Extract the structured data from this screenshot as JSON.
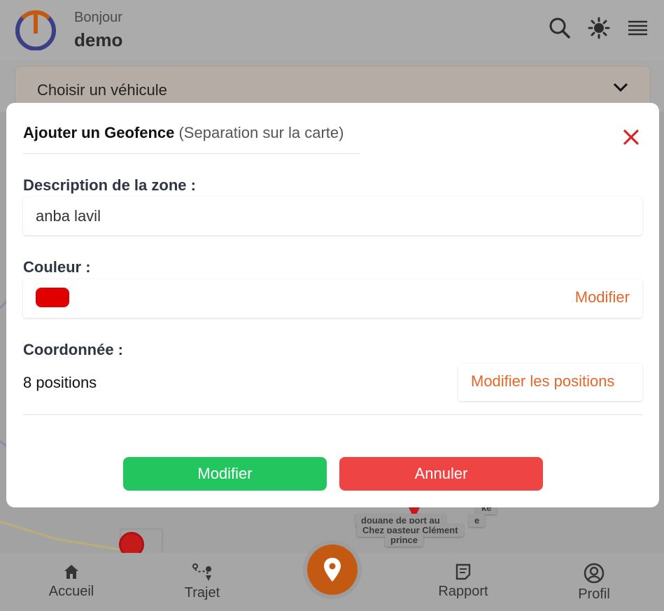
{
  "header": {
    "greeting": "Bonjour",
    "username": "demo",
    "icons": [
      "search-icon",
      "settings-sun-icon",
      "menu-icon"
    ]
  },
  "vehicle_select": {
    "label": "Choisir un véhicule"
  },
  "map": {
    "labels": [
      "douane de port au",
      "Chez pasteur Clément",
      "prince",
      "ke",
      "e"
    ]
  },
  "modal": {
    "title": "Ajouter un Geofence",
    "subtitle": "(Separation sur la carte)",
    "description_label": "Description de la zone :",
    "description_value": "anba lavil",
    "color_label": "Couleur :",
    "color_value": "#e00000",
    "color_edit": "Modifier",
    "coords_label": "Coordonnée :",
    "coords_count": "8 positions",
    "coords_edit": "Modifier les positions",
    "submit_label": "Modifier",
    "cancel_label": "Annuler"
  },
  "bottom_nav": {
    "items": [
      {
        "label": "Accueil",
        "icon": "home-icon"
      },
      {
        "label": "Trajet",
        "icon": "route-icon"
      },
      {
        "label": "",
        "icon": "location-pin-icon"
      },
      {
        "label": "Rapport",
        "icon": "report-icon"
      },
      {
        "label": "Profil",
        "icon": "profile-icon"
      }
    ]
  },
  "colors": {
    "accent": "#e2672a",
    "success": "#22c55e",
    "danger": "#ef4444",
    "brand_orange": "#c45a12",
    "brand_blue": "#3d3f86"
  }
}
